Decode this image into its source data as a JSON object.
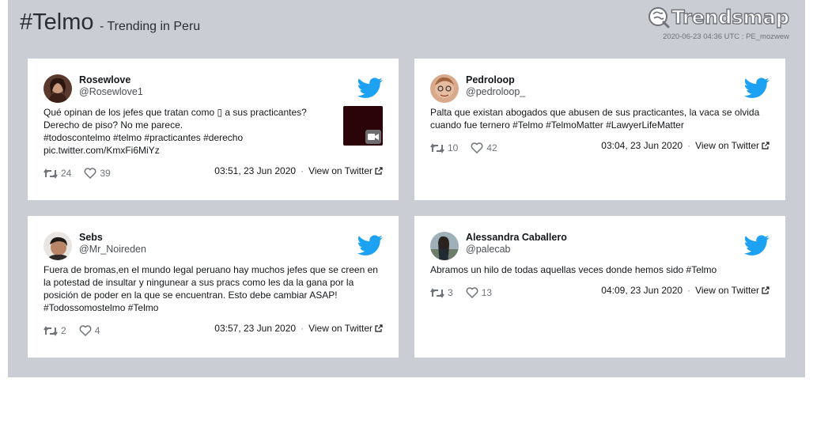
{
  "header": {
    "hashtag": "#Telmo",
    "subtitle": "- Trending in Peru",
    "logo_text": "Trendsmap",
    "timestamp": "2020-06-23 04:36 UTC : PE_mozwew"
  },
  "tweets": [
    {
      "name": "Rosewlove",
      "handle": "@Rosewlove1",
      "lines": [
        "Qué opinan de los jefes que tratan como ▯ a sus practicantes?",
        "Derecho de piso? No me parece.",
        "#todoscontelmo #telmo #practicantes #derecho",
        "pic.twitter.com/KmxFi6MiYz"
      ],
      "retweets": "24",
      "likes": "39",
      "time": "03:51, 23 Jun 2020",
      "view_label": "View on Twitter",
      "has_media": true
    },
    {
      "name": "Pedroloop",
      "handle": "@pedroloop_",
      "lines": [
        "Palta que existan abogados que abusen de sus practicantes, la vaca se olvida",
        "cuando fue ternero #Telmo #TelmoMatter #LawyerLifeMatter"
      ],
      "retweets": "10",
      "likes": "42",
      "time": "03:04, 23 Jun 2020",
      "view_label": "View on Twitter",
      "has_media": false
    },
    {
      "name": "Sebs",
      "handle": "@Mr_Noireden",
      "lines": [
        "Fuera de bromas,en el mundo legal peruano hay muchos jefes que se creen en",
        "la potestad de insultar y ningunear a sus pracs como les da la gana por la",
        "posición de poder en la que se encuentran. Esto debe cambiar ASAP!",
        "#Todossomostelmo #Telmo"
      ],
      "retweets": "2",
      "likes": "4",
      "time": "03:57, 23 Jun 2020",
      "view_label": "View on Twitter",
      "has_media": false
    },
    {
      "name": "Alessandra Caballero",
      "handle": "@palecab",
      "lines": [
        "Abramos un hilo de todas aquellas veces donde hemos sido #Telmo"
      ],
      "retweets": "3",
      "likes": "13",
      "time": "04:09, 23 Jun 2020",
      "view_label": "View on Twitter",
      "has_media": false
    }
  ],
  "colors": {
    "twitter_blue": "#1da1f2",
    "panel_bg": "#cbcdd4"
  }
}
